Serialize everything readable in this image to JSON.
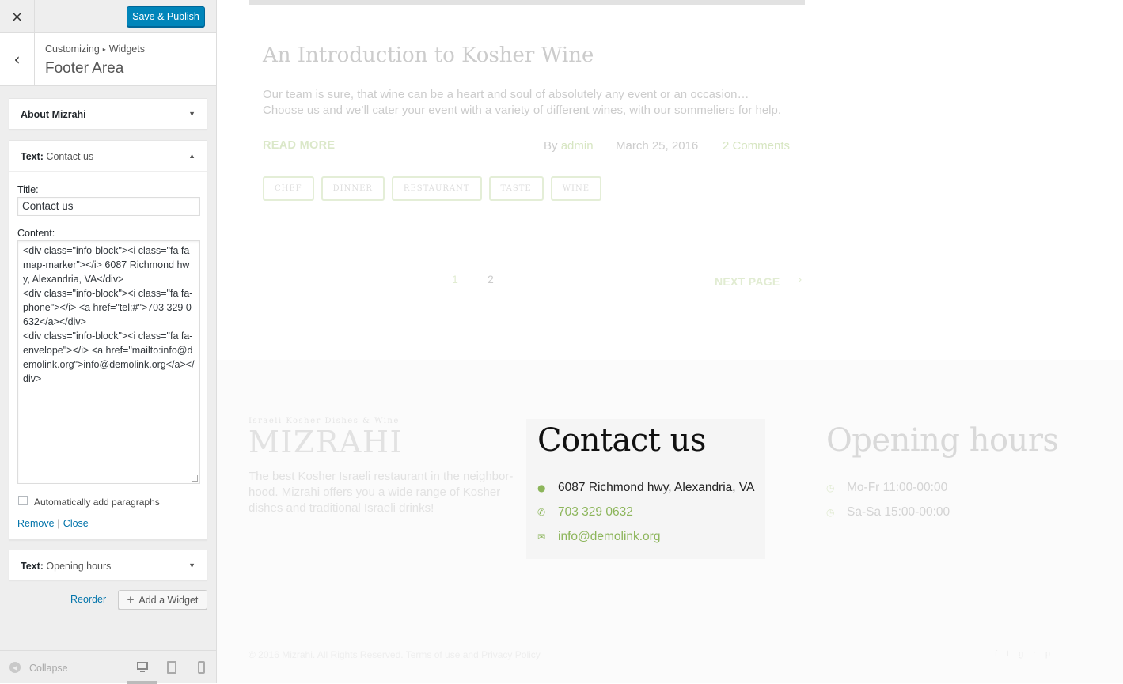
{
  "sidebar": {
    "close_icon": "×",
    "publish_label": "Save & Publish",
    "back_icon": "‹",
    "breadcrumb": [
      "Customizing",
      "Widgets"
    ],
    "breadcrumb_sep": "▸",
    "section_title": "Footer Area",
    "widgets": [
      {
        "type": "",
        "name": "About Mizrahi",
        "expanded": false
      },
      {
        "type": "Text:",
        "name": "Contact us",
        "expanded": true
      },
      {
        "type": "Text:",
        "name": "Opening hours",
        "expanded": false
      }
    ],
    "form": {
      "title_label": "Title:",
      "title_value": "Contact us",
      "content_label": "Content:",
      "content_value": "<div class=\"info-block\"><i class=\"fa fa-map-marker\"></i> 6087 Richmond hwy, Alexandria, VA</div>\n<div class=\"info-block\"><i class=\"fa fa-phone\"></i> <a href=\"tel:#\">703 329 0632</a></div>\n<div class=\"info-block\"><i class=\"fa fa-envelope\"></i> <a href=\"mailto:info@demolink.org\">info@demolink.org</a></div>",
      "autop_label": "Automatically add paragraphs",
      "autop_checked": false,
      "remove_label": "Remove",
      "separator": "|",
      "close_label": "Close"
    },
    "reorder_label": "Reorder",
    "add_widget_label": "Add a Widget",
    "add_widget_icon": "+",
    "collapse_label": "Collapse",
    "collapse_icon": "◀",
    "active_device": "desktop"
  },
  "preview": {
    "post": {
      "title": "An Introduction to Kosher Wine",
      "excerpt": "Our team is sure, that wine can be a heart and soul of absolutely any event or an occasion… Choose us and we’ll cater your event with a variety of different wines, with our sommeliers for help.",
      "read_more": "READ MORE",
      "by_label": "By",
      "author": "admin",
      "date": "March 25, 2016",
      "comments": "2 Comments",
      "tags": [
        "CHEF",
        "DINNER",
        "RESTAURANT",
        "TASTE",
        "WINE"
      ]
    },
    "pagination": {
      "pages": [
        "1",
        "2"
      ],
      "next_label": "NEXT PAGE",
      "next_icon": "›"
    },
    "footer": {
      "tagline": "Israeli Kosher Dishes & Wine",
      "brand": "MIZRAHI",
      "description": "The best Kosher Israeli restaurant in the neighbor-hood. Mizrahi offers you a wide range of Kosher dishes and traditional Israeli drinks!",
      "contact": {
        "title": "Contact us",
        "address": "6087 Richmond hwy, Alexandria, VA",
        "phone": "703 329 0632",
        "email": "info@demolink.org"
      },
      "hours": {
        "title": "Opening hours",
        "lines": [
          "Mo-Fr 11:00-00:00",
          "Sa-Sa 15:00-00:00"
        ]
      },
      "copyright": "© 2016 Mizrahi. All Rights Reserved. Terms of use and Privacy Policy"
    },
    "colors": {
      "accent": "#8cb55a",
      "publish": "#0085ba",
      "link": "#0073aa"
    }
  }
}
